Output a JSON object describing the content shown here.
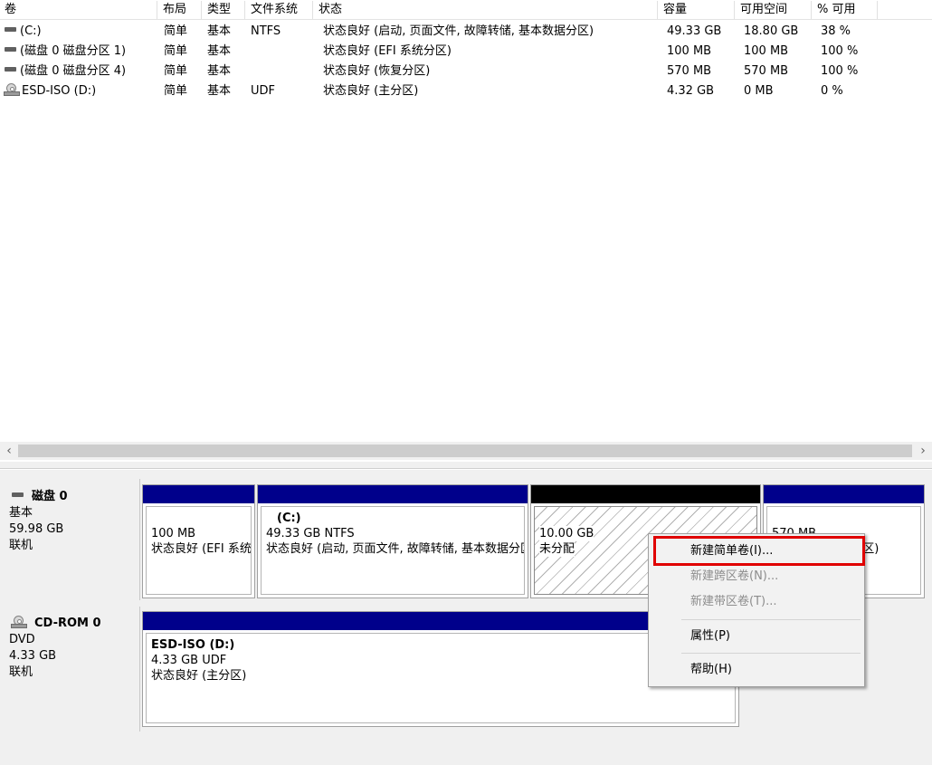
{
  "columns": [
    "卷",
    "布局",
    "类型",
    "文件系统",
    "状态",
    "容量",
    "可用空间",
    "% 可用"
  ],
  "volumes": [
    {
      "name": "(C:)",
      "layout": "简单",
      "type": "基本",
      "fs": "NTFS",
      "status": "状态良好 (启动, 页面文件, 故障转储, 基本数据分区)",
      "capacity": "49.33 GB",
      "free": "18.80 GB",
      "pct": "38 %",
      "icon": "drive-icon"
    },
    {
      "name": "(磁盘 0 磁盘分区 1)",
      "layout": "简单",
      "type": "基本",
      "fs": "",
      "status": "状态良好 (EFI 系统分区)",
      "capacity": "100 MB",
      "free": "100 MB",
      "pct": "100 %",
      "icon": "drive-icon"
    },
    {
      "name": "(磁盘 0 磁盘分区 4)",
      "layout": "简单",
      "type": "基本",
      "fs": "",
      "status": "状态良好 (恢复分区)",
      "capacity": "570 MB",
      "free": "570 MB",
      "pct": "100 %",
      "icon": "drive-icon"
    },
    {
      "name": "ESD-ISO (D:)",
      "layout": "简单",
      "type": "基本",
      "fs": "UDF",
      "status": "状态良好 (主分区)",
      "capacity": "4.32 GB",
      "free": "0 MB",
      "pct": "0 %",
      "icon": "cd-icon"
    }
  ],
  "scroll": {
    "left": "‹",
    "right": "›"
  },
  "disk0": {
    "title": "磁盘 0",
    "type": "基本",
    "size": "59.98 GB",
    "state": "联机",
    "partitions": [
      {
        "title": "",
        "size": "100 MB",
        "status": "状态良好 (EFI 系统分区)"
      },
      {
        "title": "(C:)",
        "size": "49.33 GB NTFS",
        "status": "状态良好 (启动, 页面文件, 故障转储, 基本数据分区)"
      },
      {
        "title": "",
        "size": "10.00 GB",
        "status": "未分配"
      },
      {
        "title": "",
        "size": "570 MB",
        "status": "状态良好 (恢复分区)"
      }
    ]
  },
  "cdrom0": {
    "title": "CD-ROM 0",
    "type": "DVD",
    "size": "4.33 GB",
    "state": "联机",
    "partition": {
      "title": "ESD-ISO  (D:)",
      "size": "4.33 GB UDF",
      "status": "状态良好 (主分区)"
    }
  },
  "context_menu": {
    "items": [
      {
        "label": "新建简单卷(I)...",
        "enabled": true
      },
      {
        "label": "新建跨区卷(N)...",
        "enabled": false
      },
      {
        "label": "新建带区卷(T)...",
        "enabled": false
      },
      {
        "label": "属性(P)",
        "enabled": true
      },
      {
        "label": "帮助(H)",
        "enabled": true
      }
    ]
  },
  "colors": {
    "partition_bar": "#00008b",
    "unallocated_bar": "#000000",
    "highlight": "#e00000"
  }
}
